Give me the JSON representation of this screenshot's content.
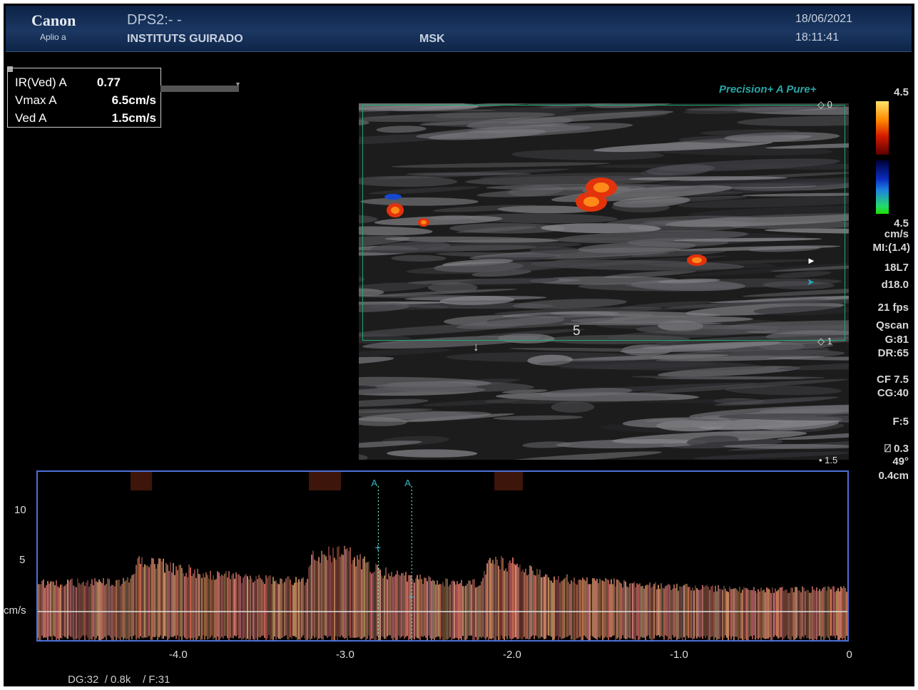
{
  "header": {
    "brand": "Canon",
    "model": "Aplio a",
    "dps": "DPS2:- -",
    "institution": "INSTITUTS GUIRADO",
    "preset": "MSK",
    "date": "18/06/2021",
    "time": "18:11:41"
  },
  "measurements": [
    {
      "label": "IR(Ved) A",
      "value": "0.77"
    },
    {
      "label": "Vmax A",
      "value": "6.5cm/s"
    },
    {
      "label": "Ved A",
      "value": "1.5cm/s"
    }
  ],
  "image": {
    "brand_precision": "Precision+",
    "brand_pure": "A Pure+",
    "depth_top": "0",
    "depth_mid": "1",
    "depth_bottom": "1.5",
    "focus_label": "5"
  },
  "side_panel": {
    "scale_top": "4.5",
    "scale_bottom": "4.5",
    "scale_unit": "cm/s",
    "mi": "MI:(1.4)",
    "probe": "18L7",
    "depth": "d18.0",
    "fps": "21 fps",
    "qscan": "Qscan",
    "gain": "G:81",
    "dr": "DR:65",
    "cf": "CF 7.5",
    "cg": "CG:40",
    "focus": "F:5",
    "angle_value": "0.3",
    "angle_deg": "49°",
    "gate": "0.4cm"
  },
  "doppler": {
    "y_ticks": [
      {
        "label": "10",
        "value": 10
      },
      {
        "label": "5",
        "value": 5
      }
    ],
    "y_unit": "cm/s",
    "x_ticks": [
      {
        "label": "-4.0",
        "value": -4
      },
      {
        "label": "-3.0",
        "value": -3
      },
      {
        "label": "-2.0",
        "value": -2
      },
      {
        "label": "-1.0",
        "value": -1
      },
      {
        "label": "0",
        "value": 0
      }
    ],
    "cursor_label": "A",
    "cursors_time": [
      -2.81,
      -2.61
    ],
    "envelope": [
      [
        -4.85,
        3
      ],
      [
        -4.3,
        3.2
      ],
      [
        -4.25,
        5.6
      ],
      [
        -4.0,
        4.5
      ],
      [
        -3.6,
        3.5
      ],
      [
        -3.25,
        3.2
      ],
      [
        -3.2,
        5.8
      ],
      [
        -3.0,
        6.3
      ],
      [
        -2.8,
        4.2
      ],
      [
        -2.4,
        3.1
      ],
      [
        -2.2,
        3.0
      ],
      [
        -2.15,
        5.3
      ],
      [
        -2.0,
        5.0
      ],
      [
        -1.8,
        3.6
      ],
      [
        -1.0,
        2.6
      ],
      [
        -0.5,
        2.3
      ],
      [
        0,
        2.4
      ]
    ]
  },
  "footer": {
    "dg": "DG:32",
    "prf": "/ 0.8k",
    "frame": "/ F:31"
  }
}
